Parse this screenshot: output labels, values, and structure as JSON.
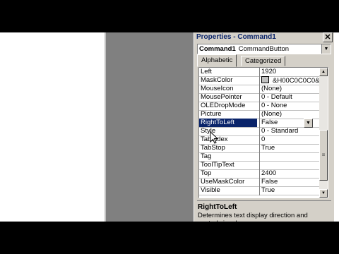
{
  "window": {
    "title": "Properties - Command1",
    "close_glyph": "✕"
  },
  "object_selector": {
    "name": "Command1",
    "type": "CommandButton",
    "dropdown_glyph": "▼"
  },
  "tabs": [
    {
      "label": "Alphabetic",
      "selected": true
    },
    {
      "label": "Categorized",
      "selected": false
    }
  ],
  "properties": [
    {
      "name": "Left",
      "value": "1920"
    },
    {
      "name": "MaskColor",
      "value": "&H00C0C0C0&"
    },
    {
      "name": "MouseIcon",
      "value": "(None)"
    },
    {
      "name": "MousePointer",
      "value": "0 - Default"
    },
    {
      "name": "OLEDropMode",
      "value": "0 - None"
    },
    {
      "name": "Picture",
      "value": "(None)"
    },
    {
      "name": "RightToLeft",
      "value": "False",
      "selected": true
    },
    {
      "name": "Style",
      "value": "0 - Standard"
    },
    {
      "name": "TabIndex",
      "value": "0"
    },
    {
      "name": "TabStop",
      "value": "True"
    },
    {
      "name": "Tag",
      "value": ""
    },
    {
      "name": "ToolTipText",
      "value": ""
    },
    {
      "name": "Top",
      "value": "2400"
    },
    {
      "name": "UseMaskColor",
      "value": "False"
    },
    {
      "name": "Visible",
      "value": "True"
    }
  ],
  "scrollbar": {
    "up_glyph": "▲",
    "down_glyph": "▼",
    "thumb_grip": "≡"
  },
  "description": {
    "title": "RightToLeft",
    "text": "Determines text display direction and control visual appearance on a"
  },
  "colors": {
    "selection": "#0a246a",
    "panel": "#d4d0c8",
    "title_text": "#0a246a",
    "mask_swatch": "#c0c0c0"
  }
}
